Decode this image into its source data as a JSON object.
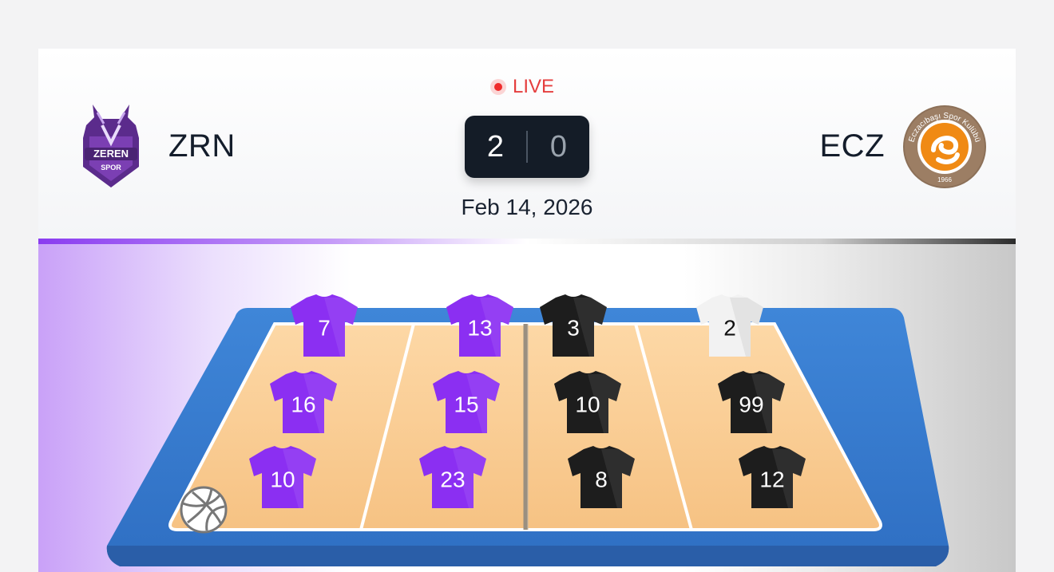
{
  "match": {
    "status": "LIVE",
    "date": "Feb 14, 2026",
    "home": {
      "abbr": "ZRN",
      "score": "2",
      "logo_text_top": "ZEREN",
      "logo_text_bottom": "SPOR"
    },
    "away": {
      "abbr": "ECZ",
      "score": "0",
      "logo_ring_text": "Eczacıbaşı Spor Kulübü",
      "logo_year": "1966"
    }
  },
  "colors": {
    "home_jersey": "#8b2ff2",
    "away_jersey": "#1d1d1d",
    "away_libero_jersey": "#f2f2f2",
    "court_floor": "#f8c88e",
    "court_border": "#3474c8",
    "live_red": "#e53e3e"
  },
  "lineup": {
    "home": [
      {
        "number": "7",
        "type": "player"
      },
      {
        "number": "13",
        "type": "player"
      },
      {
        "number": "16",
        "type": "player"
      },
      {
        "number": "15",
        "type": "player"
      },
      {
        "number": "10",
        "type": "player"
      },
      {
        "number": "23",
        "type": "player"
      }
    ],
    "away": [
      {
        "number": "3",
        "type": "player"
      },
      {
        "number": "2",
        "type": "libero"
      },
      {
        "number": "10",
        "type": "player"
      },
      {
        "number": "99",
        "type": "player"
      },
      {
        "number": "8",
        "type": "player"
      },
      {
        "number": "12",
        "type": "player"
      }
    ]
  },
  "serve": {
    "team": "home",
    "icon": "volleyball-icon"
  }
}
